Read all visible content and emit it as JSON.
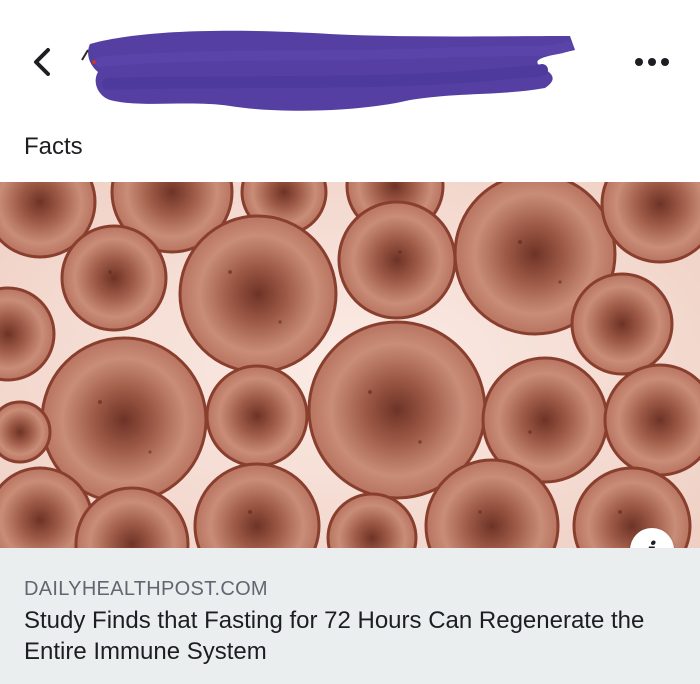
{
  "header": {
    "back_icon": "chevron-left-icon",
    "more_icon": "more-horizontal-icon",
    "redaction_color": "#553fa3"
  },
  "group": {
    "name": "Facts"
  },
  "post": {
    "image_subject": "magnified round cells",
    "info_icon": "info-icon",
    "link_domain": "DAILYHEALTHPOST.COM",
    "link_title": "Study Finds that Fasting for 72 Hours Can Regenerate the Entire Immune System"
  }
}
